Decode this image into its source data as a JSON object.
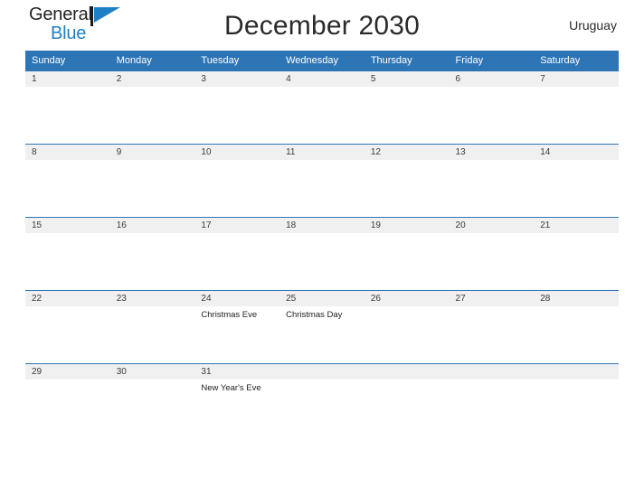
{
  "brand": {
    "name_part1": "General",
    "name_part2": "Blue",
    "flag_icon": "blue-triangle-flag-icon",
    "accent_color": "#1f7fc4"
  },
  "header": {
    "title": "December 2030",
    "region": "Uruguay"
  },
  "theme": {
    "header_blue": "#2e75b6",
    "day_band_gray": "#f0f0f0",
    "text_dark": "#2b2b2b"
  },
  "calendar": {
    "month": "December",
    "year": "2030",
    "weekday_headers": [
      "Sunday",
      "Monday",
      "Tuesday",
      "Wednesday",
      "Thursday",
      "Friday",
      "Saturday"
    ],
    "weeks": [
      [
        {
          "day": "1",
          "event": ""
        },
        {
          "day": "2",
          "event": ""
        },
        {
          "day": "3",
          "event": ""
        },
        {
          "day": "4",
          "event": ""
        },
        {
          "day": "5",
          "event": ""
        },
        {
          "day": "6",
          "event": ""
        },
        {
          "day": "7",
          "event": ""
        }
      ],
      [
        {
          "day": "8",
          "event": ""
        },
        {
          "day": "9",
          "event": ""
        },
        {
          "day": "10",
          "event": ""
        },
        {
          "day": "11",
          "event": ""
        },
        {
          "day": "12",
          "event": ""
        },
        {
          "day": "13",
          "event": ""
        },
        {
          "day": "14",
          "event": ""
        }
      ],
      [
        {
          "day": "15",
          "event": ""
        },
        {
          "day": "16",
          "event": ""
        },
        {
          "day": "17",
          "event": ""
        },
        {
          "day": "18",
          "event": ""
        },
        {
          "day": "19",
          "event": ""
        },
        {
          "day": "20",
          "event": ""
        },
        {
          "day": "21",
          "event": ""
        }
      ],
      [
        {
          "day": "22",
          "event": ""
        },
        {
          "day": "23",
          "event": ""
        },
        {
          "day": "24",
          "event": "Christmas Eve"
        },
        {
          "day": "25",
          "event": "Christmas Day"
        },
        {
          "day": "26",
          "event": ""
        },
        {
          "day": "27",
          "event": ""
        },
        {
          "day": "28",
          "event": ""
        }
      ],
      [
        {
          "day": "29",
          "event": ""
        },
        {
          "day": "30",
          "event": ""
        },
        {
          "day": "31",
          "event": "New Year's Eve"
        },
        {
          "day": "",
          "event": ""
        },
        {
          "day": "",
          "event": ""
        },
        {
          "day": "",
          "event": ""
        },
        {
          "day": "",
          "event": ""
        }
      ]
    ]
  }
}
